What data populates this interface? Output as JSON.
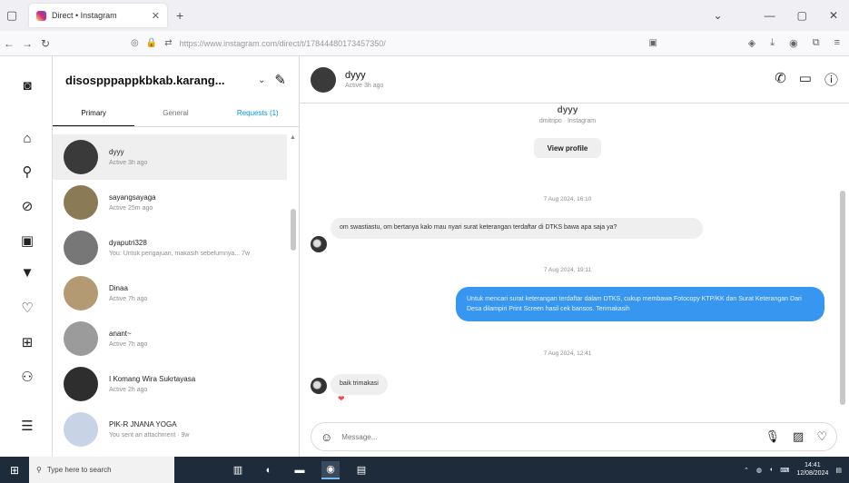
{
  "browser": {
    "tab_title": "Direct • Instagram",
    "url": "https://www.instagram.com/direct/t/17844480173457350/"
  },
  "ig": {
    "username": "disospppappkbkab.karang...",
    "tabs": [
      {
        "label": "Primary"
      },
      {
        "label": "General"
      },
      {
        "label": "Requests (1)"
      }
    ],
    "conversations": [
      {
        "name": "dyyy",
        "sub": "Active 3h ago",
        "avatar_color": "#3a3a3a"
      },
      {
        "name": "sayangsayaga",
        "sub": "Active 25m ago",
        "avatar_color": "#8a7a55"
      },
      {
        "name": "dyaputri328",
        "sub": "You: Untuk pengajuan, makasih sebelumnya... 7w",
        "avatar_color": "#777777"
      },
      {
        "name": "Dinaa",
        "sub": "Active 7h ago",
        "avatar_color": "#b49a72"
      },
      {
        "name": "anant~",
        "sub": "Active 7h ago",
        "avatar_color": "#9b9b9b"
      },
      {
        "name": "I Komang Wira Sukrtayasa",
        "sub": "Active 2h ago",
        "avatar_color": "#2e2e2e"
      },
      {
        "name": "PIK-R JNANA YOGA",
        "sub": "You sent an attachment · 9w",
        "avatar_color": "#c9d3e6"
      }
    ],
    "chat": {
      "name": "dyyy",
      "status": "Active 3h ago",
      "profile_name": "dyyy",
      "profile_sub": "dmitripo · Instagram",
      "view_profile": "View profile",
      "timestamps": [
        "7 Aug 2024, 16:10",
        "7 Aug 2024, 19:11",
        "7 Aug 2024, 12:41"
      ],
      "messages": [
        {
          "from": "them",
          "text": "om swastiastu, om bertanya kalo mau nyari surat keterangan terdaftar di DTKS bawa apa saja ya?"
        },
        {
          "from": "me",
          "text": "Untuk mencari surat keterangan terdaftar dalam DTKS, cukup membawa Fotocopy KTP/KK dan Surat Keterangan Dari Desa dilampiri Print Screen hasil cek bansos. Terimakasih"
        },
        {
          "from": "them",
          "text": "baik trimakasi"
        }
      ],
      "reaction": "❤",
      "composer_placeholder": "Message..."
    }
  },
  "taskbar": {
    "search_placeholder": "Type here to search",
    "time": "14:41",
    "date": "12/08/2024"
  },
  "colors": {
    "accent_blue": "#3797f0",
    "link_blue": "#0095f6",
    "heart_red": "#ed4956"
  }
}
